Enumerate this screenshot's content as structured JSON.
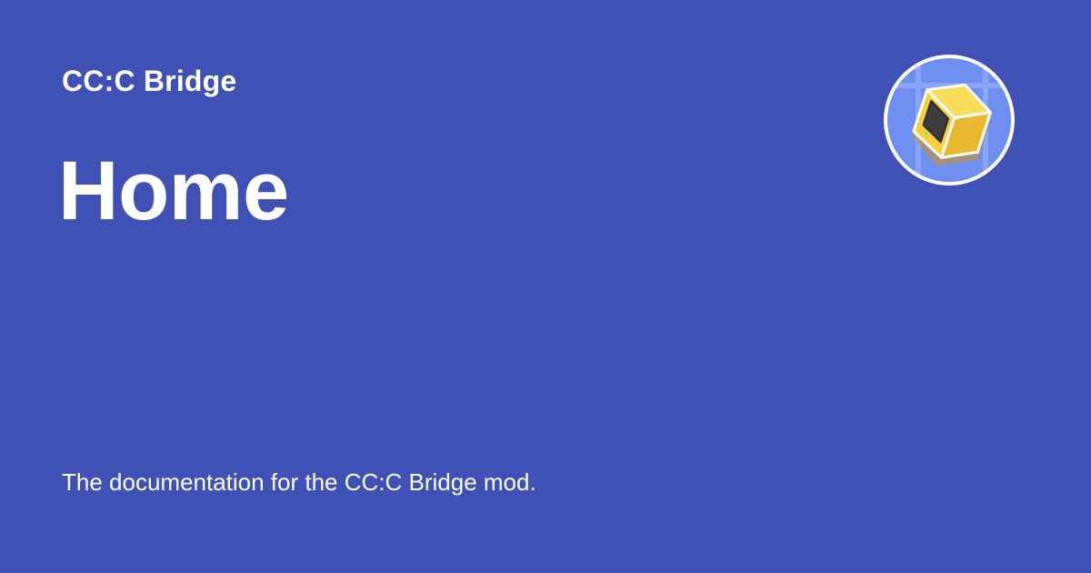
{
  "site": {
    "name": "CC:C Bridge"
  },
  "page": {
    "title": "Home",
    "description": "The documentation for the CC:C Bridge mod."
  },
  "logo": {
    "icon": "cube-computer-icon"
  },
  "colors": {
    "background": "#3f51b5",
    "text": "#ffffff",
    "logo_ring": "#ffffff",
    "logo_bg": "#6f8ff0",
    "cube_yellow": "#f5d03a",
    "cube_screen": "#3c3c3c"
  }
}
